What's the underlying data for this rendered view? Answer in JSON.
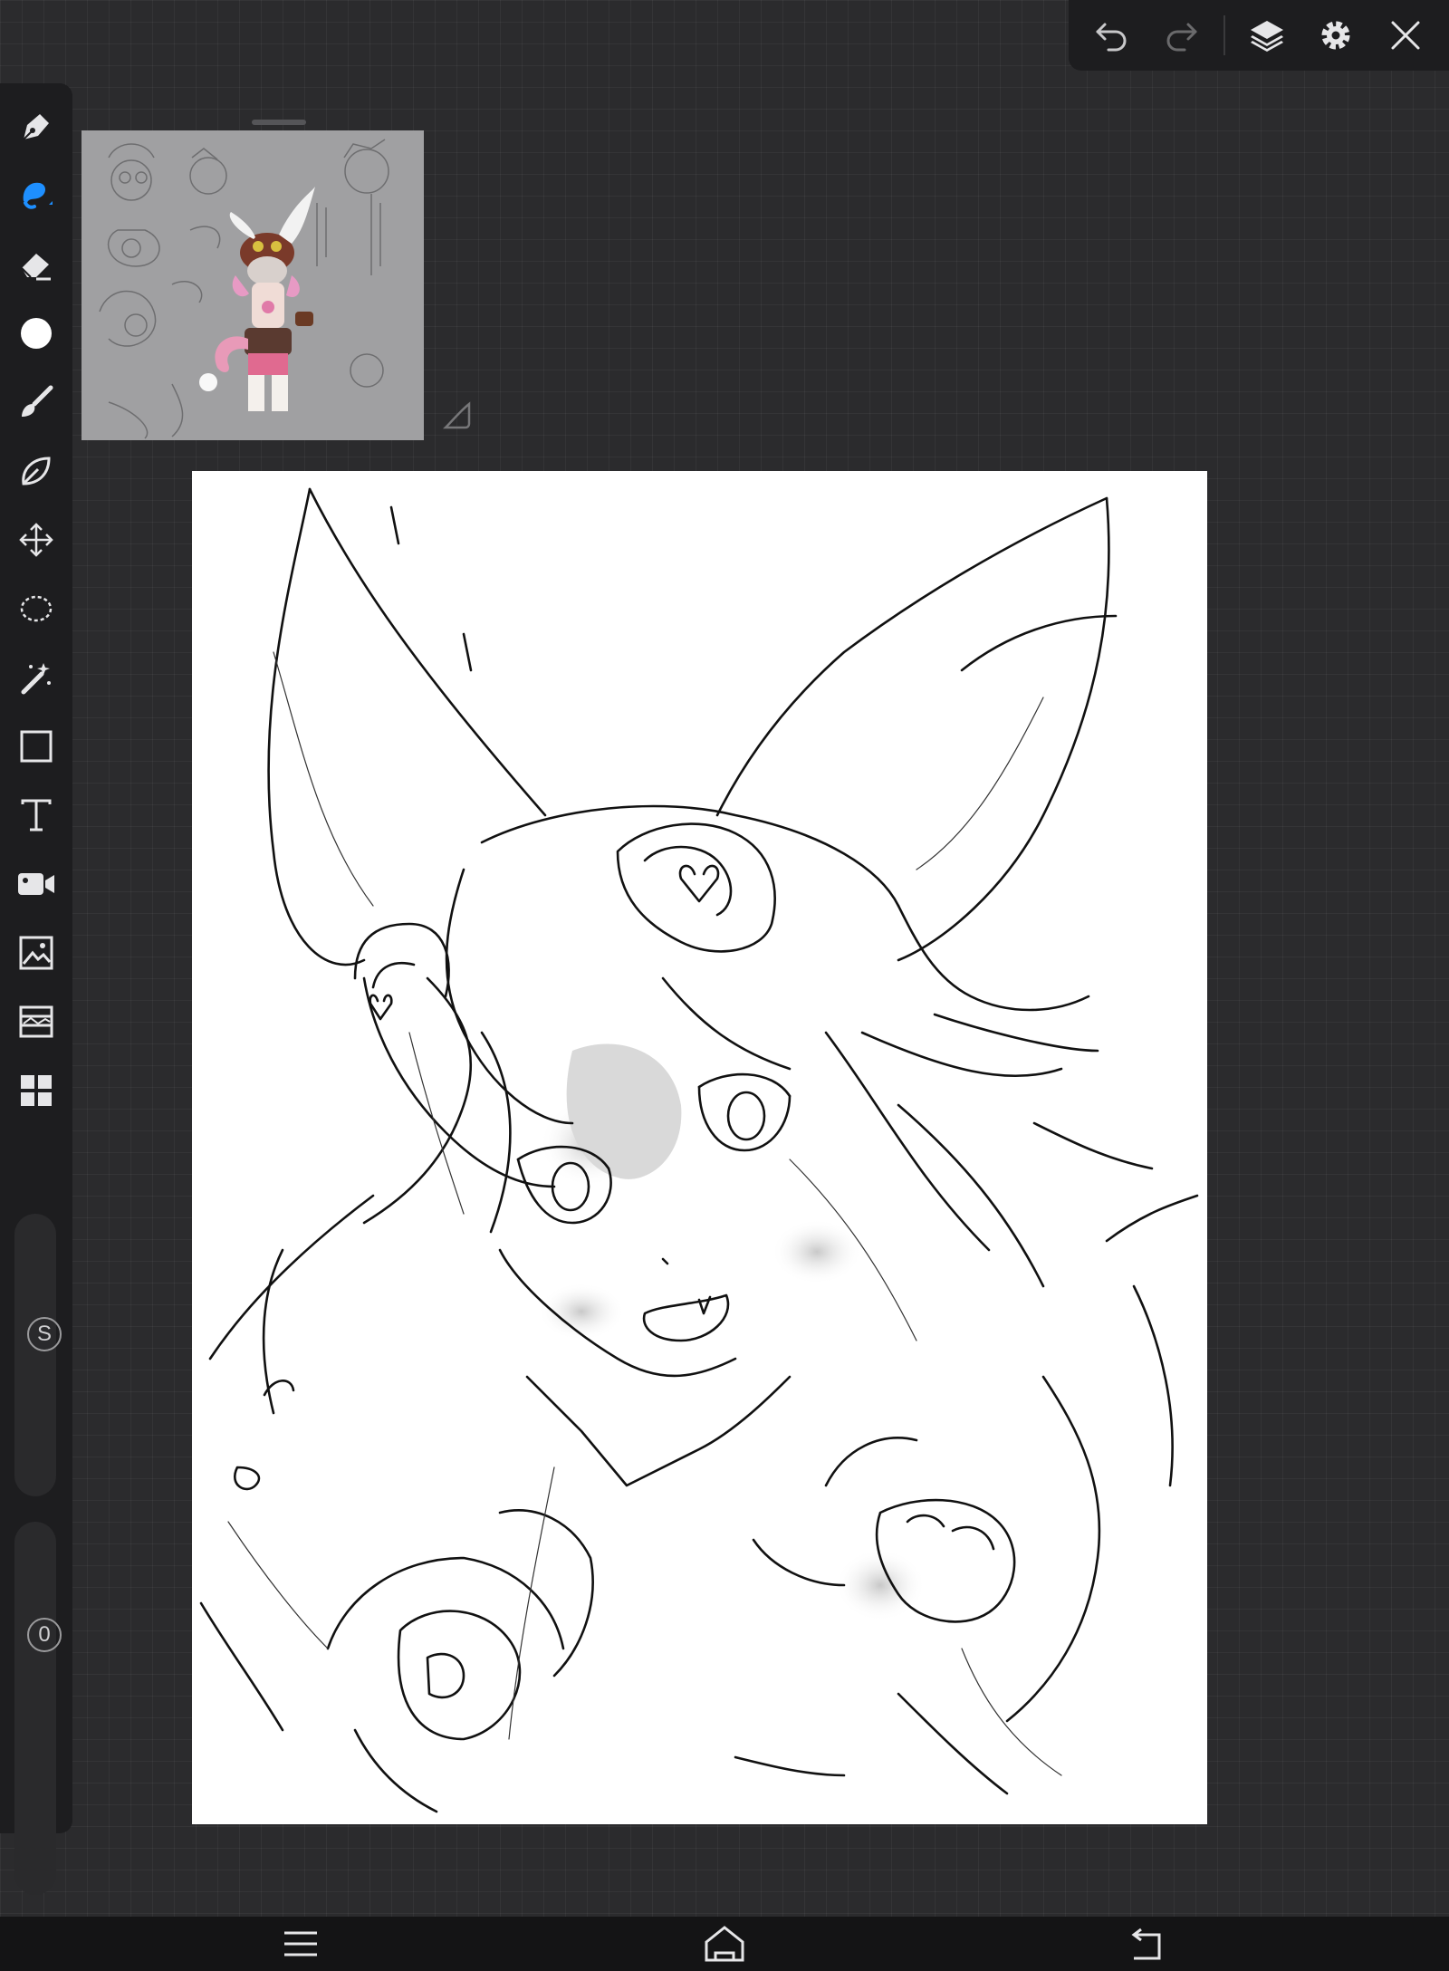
{
  "topbar": {
    "buttons": [
      {
        "name": "undo-icon"
      },
      {
        "name": "redo-icon"
      },
      {
        "name": "layers-icon"
      },
      {
        "name": "settings-icon"
      },
      {
        "name": "close-icon"
      }
    ]
  },
  "toolbar": {
    "tools": [
      {
        "name": "pen-tool"
      },
      {
        "name": "brush-tool",
        "active": true
      },
      {
        "name": "eraser-tool"
      },
      {
        "name": "color-picker"
      },
      {
        "name": "smudge-tool"
      },
      {
        "name": "liquify-tool"
      },
      {
        "name": "transform-tool"
      },
      {
        "name": "lasso-select-tool"
      },
      {
        "name": "magic-wand-tool"
      },
      {
        "name": "shape-tool"
      },
      {
        "name": "text-tool"
      },
      {
        "name": "video-tool"
      },
      {
        "name": "image-import-tool"
      },
      {
        "name": "filter-tool"
      },
      {
        "name": "gallery-tool"
      }
    ],
    "size_slider": {
      "label": "S"
    },
    "opacity_slider": {
      "label": "0"
    }
  },
  "colors": {
    "accent": "#1e8fff",
    "icon": "#e6e6e8",
    "panel": "#1d1d1f",
    "background": "#2b2b2d"
  },
  "navbar": {
    "buttons": [
      {
        "name": "menu-icon"
      },
      {
        "name": "home-icon"
      },
      {
        "name": "back-icon"
      }
    ]
  }
}
